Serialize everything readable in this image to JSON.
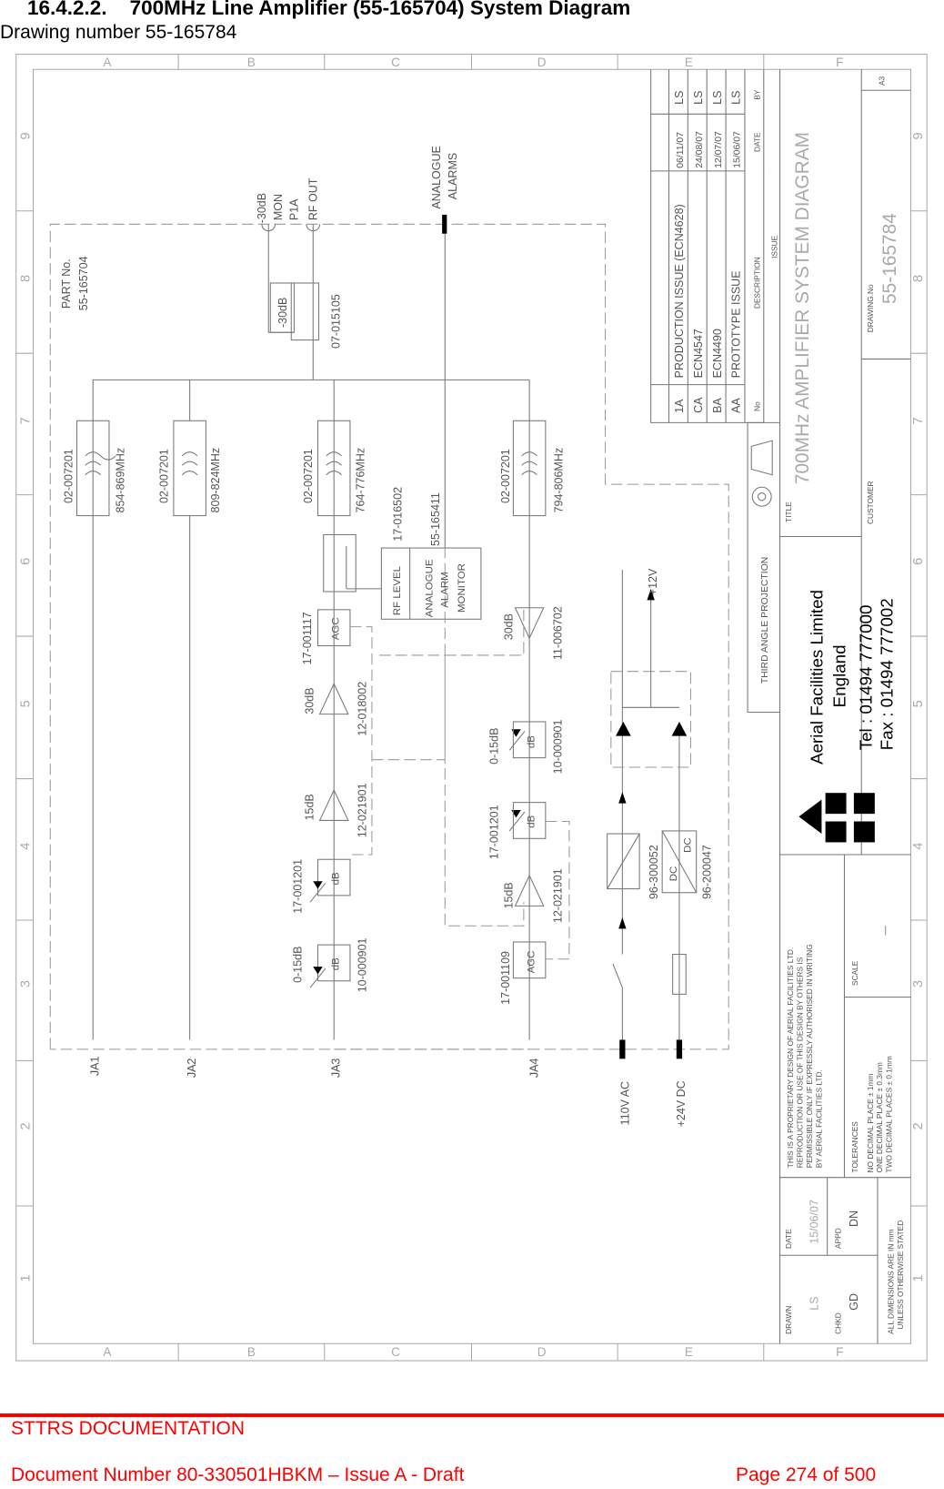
{
  "header": {
    "heading": "16.4.2.2.    700MHz Line Amplifier (55-165704) System Diagram",
    "subheading": "Drawing number 55-165784"
  },
  "drawing": {
    "grid_columns": [
      "A",
      "B",
      "C",
      "D",
      "E",
      "F"
    ],
    "grid_rows": [
      "9",
      "8",
      "7",
      "6",
      "5",
      "4",
      "3",
      "2",
      "1"
    ],
    "part_no_label": "PART No.",
    "part_no": "55-165704",
    "mon_port": [
      "-30dB",
      "MON",
      "P1A",
      "RF OUT"
    ],
    "alarms": [
      "ANALOGUE",
      "ALARMS"
    ],
    "coupler_value": "-30dB",
    "coupler_part": "07-015105",
    "filters": [
      {
        "part": "02-007201",
        "band": "854-869MHz"
      },
      {
        "part": "02-007201",
        "band": "809-824MHz"
      },
      {
        "part": "02-007201",
        "band": "764-776MHz"
      },
      {
        "part": "02-007201",
        "band": "794-806MHz"
      }
    ],
    "monitor_parts": [
      "17-016502",
      "55-165411"
    ],
    "monitor_box": {
      "rf_level": "RF LEVEL",
      "lines": [
        "ANALOGUE",
        "ALARM",
        "MONITOR"
      ]
    },
    "chain_ja3": {
      "agc": "AGC",
      "agc_part": "17-001117",
      "amp1_gain": "30dB",
      "amp1_part": "12-018002",
      "amp2_gain": "15dB",
      "amp2_part": "12-021901",
      "att1_label": "dB",
      "att1_part": "17-001201",
      "att2_label": "dB",
      "att2_range": "0-15dB",
      "att2_part": "10-000901"
    },
    "chain_ja4": {
      "agc": "AGC",
      "agc_part": "17-001109",
      "amp1_gain": "15dB",
      "amp1_part": "12-021901",
      "att1_label": "dB",
      "att1_part": "17-001201",
      "att2_label": "dB",
      "att2_range": "0-15dB",
      "att2_part": "10-000901",
      "amp2_gain": "30dB",
      "amp2_part": "11-006702"
    },
    "ports": [
      "JA1",
      "JA2",
      "JA3",
      "JA4"
    ],
    "power": {
      "out": "+12V",
      "ac_in": "110V AC",
      "dc_in": "+24V DC",
      "psu_part": "96-300052",
      "dcdc_part": "96-200047",
      "dcdc_label": "DC"
    },
    "revisions": {
      "headers": {
        "no": "No",
        "description": "DESCRIPTION",
        "date": "DATE",
        "by": "BY",
        "issue": "ISSUE"
      },
      "rows": [
        {
          "no": "1A",
          "description": "PRODUCTION ISSUE (ECN4628)",
          "date": "06/11/07",
          "by": "LS"
        },
        {
          "no": "CA",
          "description": "ECN4547",
          "date": "24/08/07",
          "by": "LS"
        },
        {
          "no": "BA",
          "description": "ECN4490",
          "date": "12/07/07",
          "by": "LS"
        },
        {
          "no": "AA",
          "description": "PROTOTYPE ISSUE",
          "date": "15/06/07",
          "by": "LS"
        }
      ]
    },
    "title_block": {
      "projection": "THIRD ANGLE PROJECTION",
      "title_label": "TITLE",
      "title": "700MHz AMPLIFIER SYSTEM DIAGRAM",
      "customer_label": "CUSTOMER",
      "drawing_no_label": "DRAWING.No",
      "drawing_no": "55-165784",
      "sheet_size": "A3",
      "company": "Aerial Facilities Limited",
      "country": "England",
      "tel": "Tel : 01494 777000",
      "fax": "Fax : 01494 777002",
      "disclaimer": [
        "THIS IS A PROPRIETARY DESIGN OF AERIAL FACILITIES LTD.",
        "REPRODUCTION OR USE OF THIS DESIGN BY OTHERS IS",
        "PERMISSIBLE ONLY IF EXPRESSLY AUTHORISED IN WRITING",
        "BY AERIAL FACILITIES LTD."
      ],
      "tolerances_label": "TOLERANCES",
      "tolerances": [
        "NO DECIMAL PLACE ± 1mm",
        "ONE DECIMAL PLACE ± 0.3mm",
        "TWO DECIMAL PLACES ± 0.1mm"
      ],
      "scale_label": "SCALE",
      "scale": "—",
      "drawn_label": "DRAWN",
      "drawn": "LS",
      "date_label": "DATE",
      "date": "15/06/07",
      "chkd_label": "CHKD",
      "chkd": "GD",
      "appd_label": "APPD",
      "appd": "DN",
      "dimensions_note": [
        "ALL DIMENSIONS ARE IN mm",
        "UNLESS OTHERWISE STATED"
      ]
    }
  },
  "footer": {
    "org": "STTRS DOCUMENTATION",
    "document": "Document Number 80-330501HBKM – Issue A - Draft",
    "page": "Page 274 of 500",
    "accent": "#ff0000"
  }
}
